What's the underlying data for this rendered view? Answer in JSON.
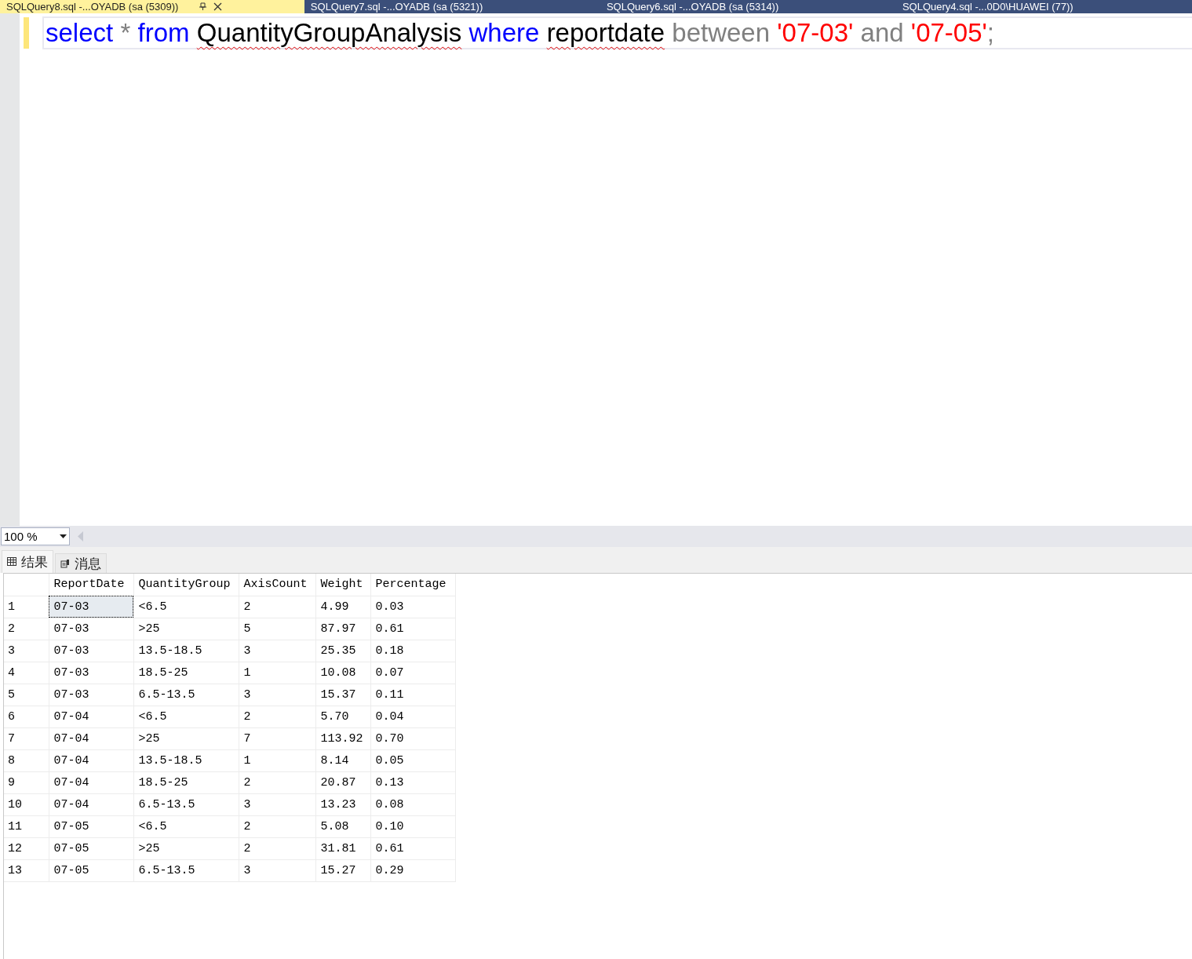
{
  "document_tabs": [
    {
      "title": "SQLQuery8.sql -...OYADB (sa (5309))",
      "selected": true
    },
    {
      "title": "SQLQuery7.sql -...OYADB (sa (5321))",
      "selected": false
    },
    {
      "title": "SQLQuery6.sql -...OYADB (sa (5314))",
      "selected": false
    },
    {
      "title": "SQLQuery4.sql -...0D0\\HUAWEI (77))",
      "selected": false
    }
  ],
  "editor": {
    "lines": [
      {
        "modified": true,
        "tokens": [
          {
            "text": "select",
            "kind": "keyword",
            "error": false
          },
          {
            "text": "*",
            "kind": "operator",
            "error": false
          },
          {
            "text": "from",
            "kind": "keyword",
            "error": false
          },
          {
            "text": "QuantityGroupAnalysis",
            "kind": "identifier",
            "error": true
          },
          {
            "text": "where",
            "kind": "keyword",
            "error": false
          },
          {
            "text": "reportdate",
            "kind": "identifier",
            "error": true
          },
          {
            "text": "between",
            "kind": "operator",
            "error": false
          },
          {
            "text": "'07-03'",
            "kind": "string",
            "error": false
          },
          {
            "text": "and",
            "kind": "operator",
            "error": false
          },
          {
            "text": "'07-05'",
            "kind": "string",
            "error": false
          },
          {
            "text": ";",
            "kind": "punctuation",
            "error": false
          }
        ]
      }
    ]
  },
  "zoom": {
    "value": "100 %"
  },
  "result_tabs": [
    {
      "label": "结果",
      "kind": "grid",
      "selected": true
    },
    {
      "label": "消息",
      "kind": "messages",
      "selected": false
    }
  ],
  "table": {
    "columns": [
      "ReportDate",
      "QuantityGroup",
      "AxisCount",
      "Weight",
      "Percentage"
    ],
    "rows": [
      {
        "number": "1",
        "cells": [
          "07-03",
          "<6.5",
          "2",
          "4.99",
          "0.03"
        ],
        "selected": true
      },
      {
        "number": "2",
        "cells": [
          "07-03",
          ">25",
          "5",
          "87.97",
          "0.61"
        ],
        "selected": false
      },
      {
        "number": "3",
        "cells": [
          "07-03",
          "13.5-18.5",
          "3",
          "25.35",
          "0.18"
        ],
        "selected": false
      },
      {
        "number": "4",
        "cells": [
          "07-03",
          "18.5-25",
          "1",
          "10.08",
          "0.07"
        ],
        "selected": false
      },
      {
        "number": "5",
        "cells": [
          "07-03",
          "6.5-13.5",
          "3",
          "15.37",
          "0.11"
        ],
        "selected": false
      },
      {
        "number": "6",
        "cells": [
          "07-04",
          "<6.5",
          "2",
          "5.70",
          "0.04"
        ],
        "selected": false
      },
      {
        "number": "7",
        "cells": [
          "07-04",
          ">25",
          "7",
          "113.92",
          "0.70"
        ],
        "selected": false
      },
      {
        "number": "8",
        "cells": [
          "07-04",
          "13.5-18.5",
          "1",
          "8.14",
          "0.05"
        ],
        "selected": false
      },
      {
        "number": "9",
        "cells": [
          "07-04",
          "18.5-25",
          "2",
          "20.87",
          "0.13"
        ],
        "selected": false
      },
      {
        "number": "10",
        "cells": [
          "07-04",
          "6.5-13.5",
          "3",
          "13.23",
          "0.08"
        ],
        "selected": false
      },
      {
        "number": "11",
        "cells": [
          "07-05",
          "<6.5",
          "2",
          "5.08",
          "0.10"
        ],
        "selected": false
      },
      {
        "number": "12",
        "cells": [
          "07-05",
          ">25",
          "2",
          "31.81",
          "0.61"
        ],
        "selected": false
      },
      {
        "number": "13",
        "cells": [
          "07-05",
          "6.5-13.5",
          "3",
          "15.27",
          "0.29"
        ],
        "selected": false
      }
    ]
  }
}
